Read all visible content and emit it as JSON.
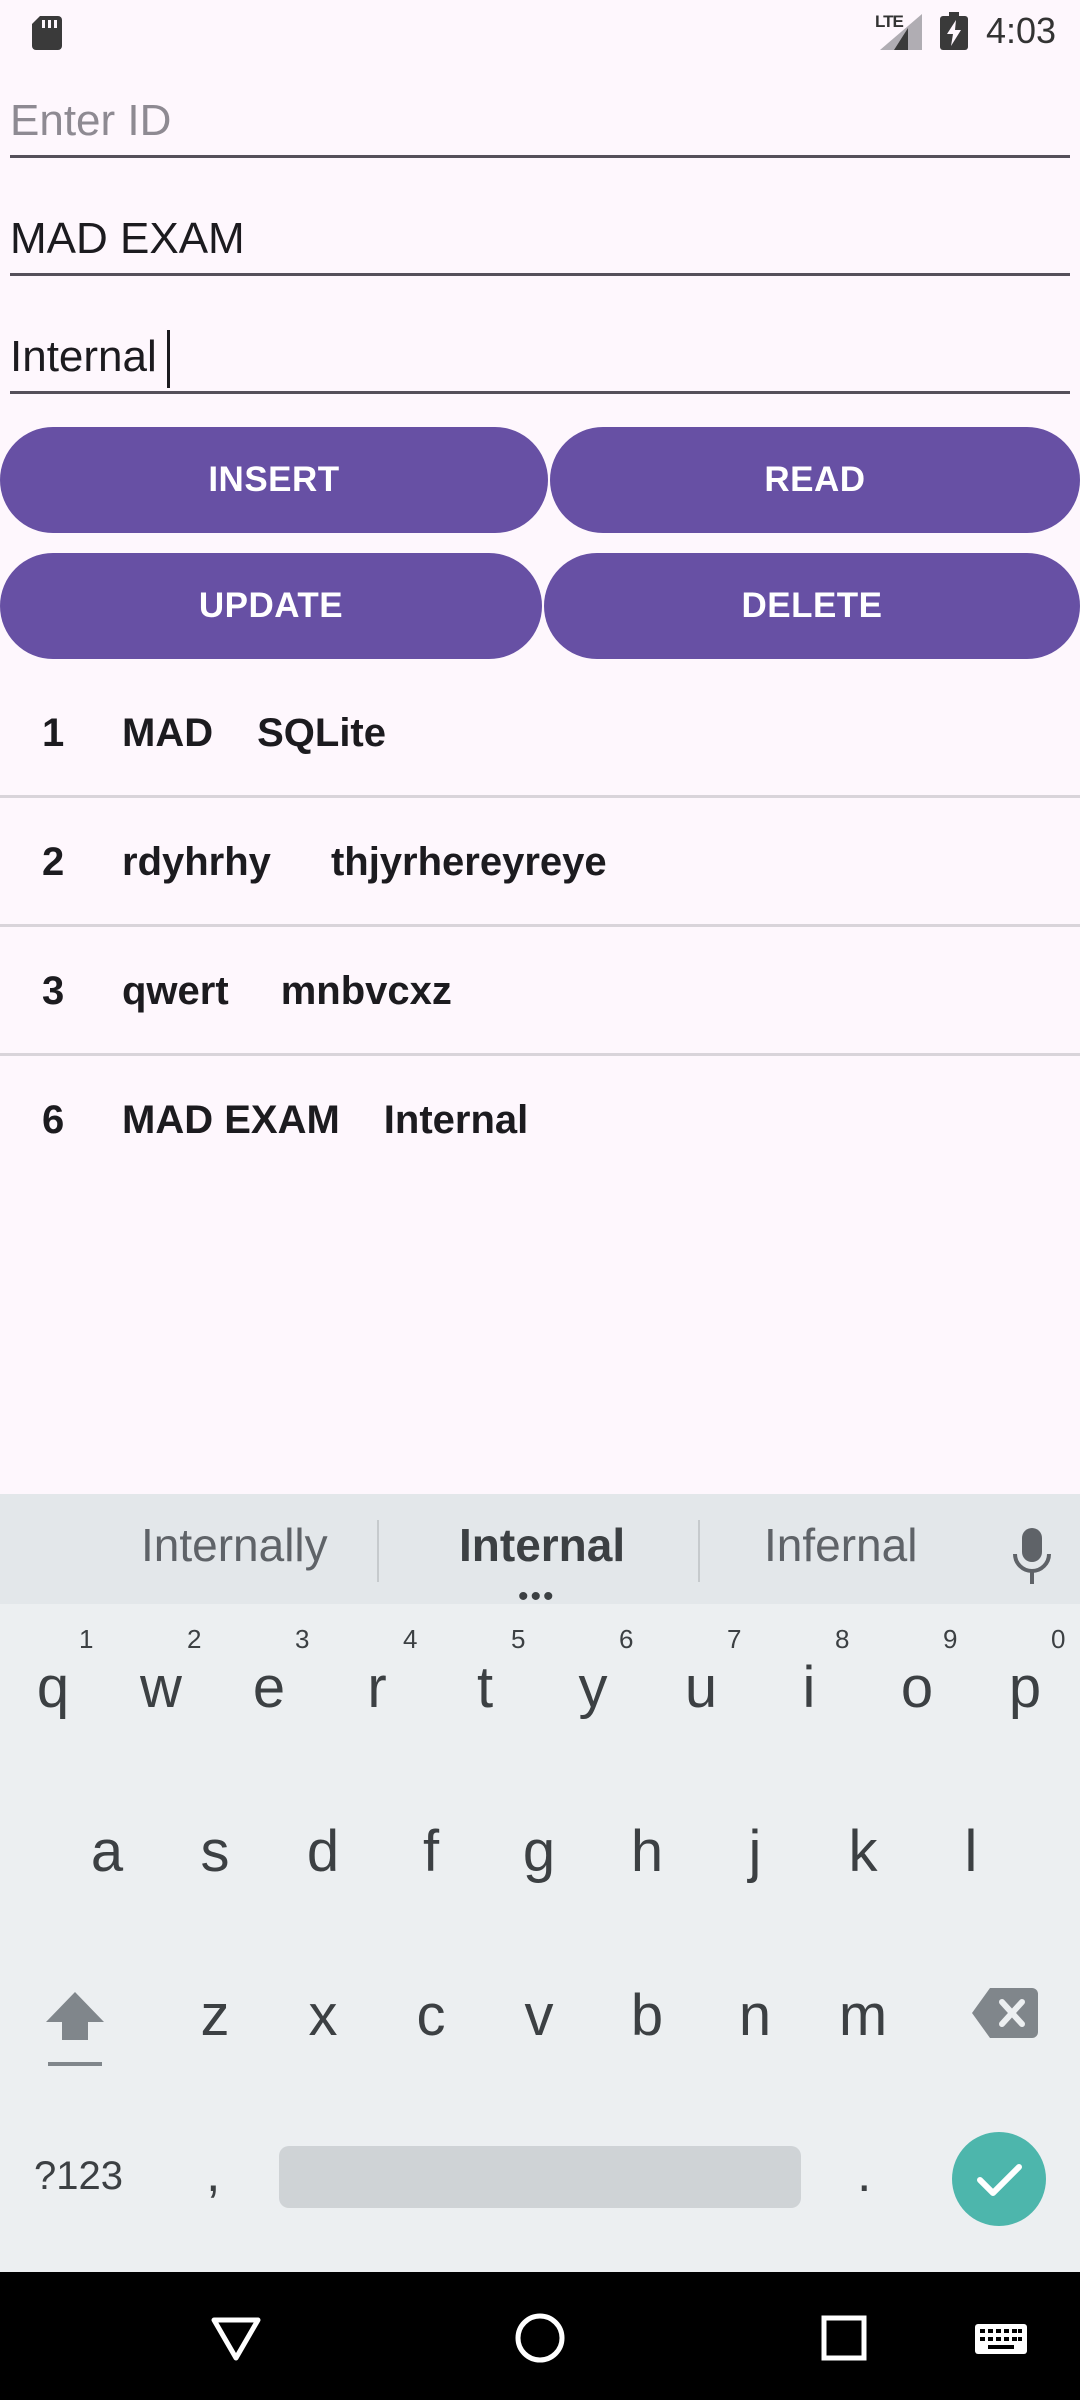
{
  "status_bar": {
    "time": "4:03",
    "network": "LTE"
  },
  "form": {
    "id_placeholder": "Enter ID",
    "name_value": "MAD EXAM",
    "course_value": "Internal"
  },
  "buttons": {
    "insert": "INSERT",
    "read": "READ",
    "update": "UPDATE",
    "delete": "DELETE"
  },
  "records": [
    {
      "id": "1",
      "name": "MAD",
      "course": "SQLite"
    },
    {
      "id": "2",
      "name": "rdyhrhy",
      "course": "thjyrhereyreye"
    },
    {
      "id": "3",
      "name": "qwert",
      "course": "mnbvcxz"
    },
    {
      "id": "6",
      "name": "MAD EXAM",
      "course": "Internal"
    }
  ],
  "keyboard": {
    "suggestions": [
      "Internally",
      "Internal",
      "Infernal"
    ],
    "row1": [
      "q",
      "w",
      "e",
      "r",
      "t",
      "y",
      "u",
      "i",
      "o",
      "p"
    ],
    "row1_hints": [
      "1",
      "2",
      "3",
      "4",
      "5",
      "6",
      "7",
      "8",
      "9",
      "0"
    ],
    "row2": [
      "a",
      "s",
      "d",
      "f",
      "g",
      "h",
      "j",
      "k",
      "l"
    ],
    "row3": [
      "z",
      "x",
      "c",
      "v",
      "b",
      "n",
      "m"
    ],
    "symbols_label": "?123",
    "comma": ",",
    "period": "."
  }
}
